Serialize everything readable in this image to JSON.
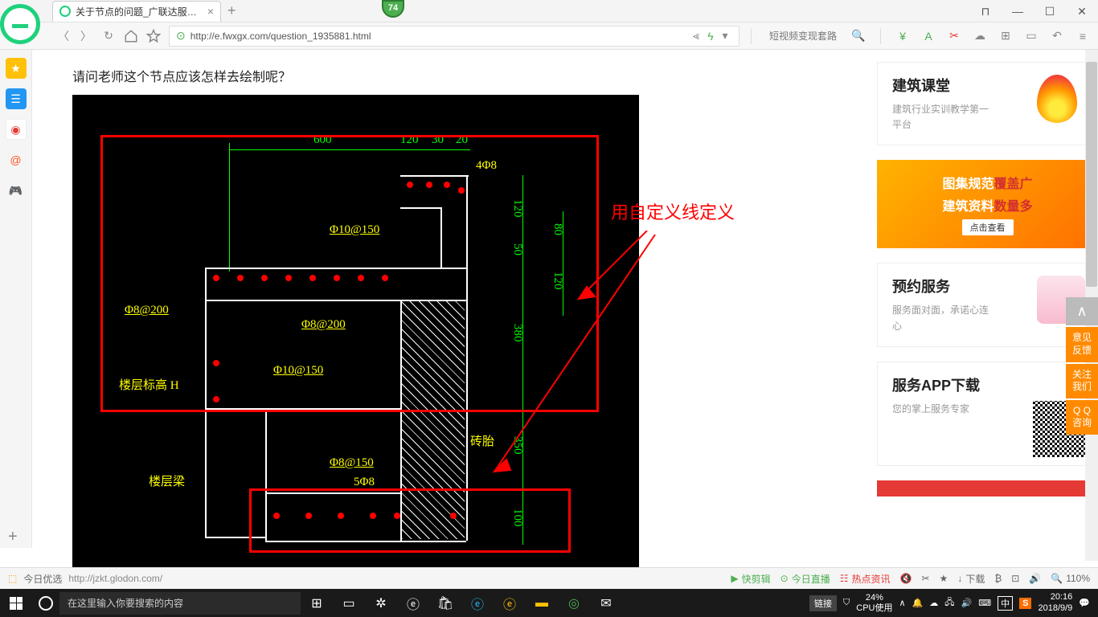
{
  "browser": {
    "tab_title": "关于节点的问题_广联达服务新干线",
    "badge": "74",
    "url": "http://e.fwxgx.com/question_1935881.html",
    "promo": "短视频变现套路",
    "window_controls": {
      "pin": "⊓",
      "min": "—",
      "max": "☐",
      "close": "✕"
    }
  },
  "page": {
    "question": "请问老师这个节点应该怎样去绘制呢？",
    "annotation": "用自定义线定义",
    "cad": {
      "dims_top": {
        "d600": "600",
        "d120": "120",
        "d30": "30",
        "d20": "20"
      },
      "dims_right": {
        "d120a": "120",
        "d80": "80",
        "d50": "50",
        "d120b": "120",
        "d380": "380",
        "d350": "350",
        "d100": "100"
      },
      "labels": {
        "rebar_4phi8": "4Φ8",
        "phi10_150a": "Φ10@150",
        "phi8_200a": "Φ8@200",
        "phi8_200b": "Φ8@200",
        "phi10_150b": "Φ10@150",
        "phi8_150": "Φ8@150",
        "rebar_5phi8": "5Φ8",
        "floor_elev": "楼层标高 H",
        "floor_beam": "楼层梁",
        "brick": "砖胎"
      }
    }
  },
  "sidebar_cards": {
    "card1": {
      "title": "建筑课堂",
      "desc": "建筑行业实训教学第一平台"
    },
    "banner": {
      "line1a": "图集规范",
      "line1b": "覆盖广",
      "line2a": "建筑资料",
      "line2b": "数量多",
      "btn": "点击查看"
    },
    "card2": {
      "title": "预约服务",
      "desc": "服务面对面，承诺心连心"
    },
    "card3": {
      "title": "服务APP下载",
      "desc": "您的掌上服务专家"
    }
  },
  "float_tabs": {
    "feedback": "意见反馈",
    "follow": "关注我们",
    "qq": "Q Q咨询"
  },
  "statusbar": {
    "today_pick": "今日优选",
    "url_preview": "http://jzkt.glodon.com/",
    "kuaijian": "快剪辑",
    "live": "今日直播",
    "hot": "热点资讯",
    "download": "下载",
    "zoom": "110%"
  },
  "taskbar": {
    "search_placeholder": "在这里输入你要搜索的内容",
    "link": "链接",
    "cpu_pct": "24%",
    "cpu_lbl": "CPU使用",
    "ime": "中",
    "sogou": "S",
    "time": "20:16",
    "date": "2018/9/9"
  }
}
